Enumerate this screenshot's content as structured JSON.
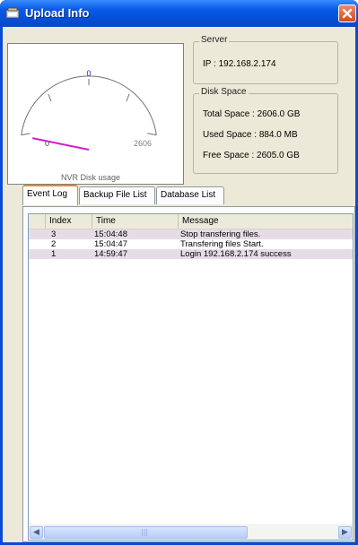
{
  "window": {
    "title": "Upload Info"
  },
  "gauge": {
    "caption": "NVR Disk usage",
    "top_label": "0",
    "min_label": "0",
    "max_label": "2606",
    "level_fraction": 0.0003
  },
  "server": {
    "group_title": "Server",
    "ip": "IP : 192.168.2.174"
  },
  "disk": {
    "group_title": "Disk Space",
    "total": "Total Space : 2606.0 GB",
    "used": "Used Space : 884.0 MB",
    "free": "Free Space : 2605.0 GB"
  },
  "tabs": [
    {
      "label": "Event Log"
    },
    {
      "label": "Backup File List"
    },
    {
      "label": "Database List"
    }
  ],
  "event_log": {
    "columns": [
      "Index",
      "Time",
      "Message"
    ],
    "rows": [
      {
        "index": "3",
        "time": "15:04:48",
        "message": "Stop transfering files."
      },
      {
        "index": "2",
        "time": "15:04:47",
        "message": "Transfering files Start."
      },
      {
        "index": "1",
        "time": "14:59:47",
        "message": "Login 192.168.2.174 success"
      }
    ]
  },
  "colors": {
    "needle": "#d020d0",
    "row_alt": "#e6dce6",
    "accent_tab": "#e68b2c"
  }
}
